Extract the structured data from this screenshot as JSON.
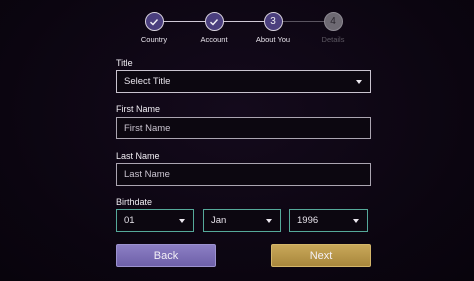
{
  "stepper": {
    "steps": [
      {
        "label": "Country",
        "state": "done",
        "icon": "check-icon"
      },
      {
        "label": "Account",
        "state": "done",
        "icon": "check-icon"
      },
      {
        "label": "About You",
        "state": "current",
        "number": "3"
      },
      {
        "label": "Details",
        "state": "upcoming",
        "number": "4"
      }
    ]
  },
  "form": {
    "title": {
      "label": "Title",
      "value": "Select Title"
    },
    "first_name": {
      "label": "First Name",
      "placeholder": "First Name"
    },
    "last_name": {
      "label": "Last Name",
      "placeholder": "Last Name"
    },
    "birthdate": {
      "label": "Birthdate",
      "day": "01",
      "month": "Jan",
      "year": "1996"
    }
  },
  "buttons": {
    "back_label": "Back",
    "next_label": "Next"
  },
  "colors": {
    "background": "#0d0612",
    "step_active": "#4b3f7e",
    "back_button": "#7a6db5",
    "next_button": "#b8974a",
    "birthdate_border": "#55a99a"
  }
}
